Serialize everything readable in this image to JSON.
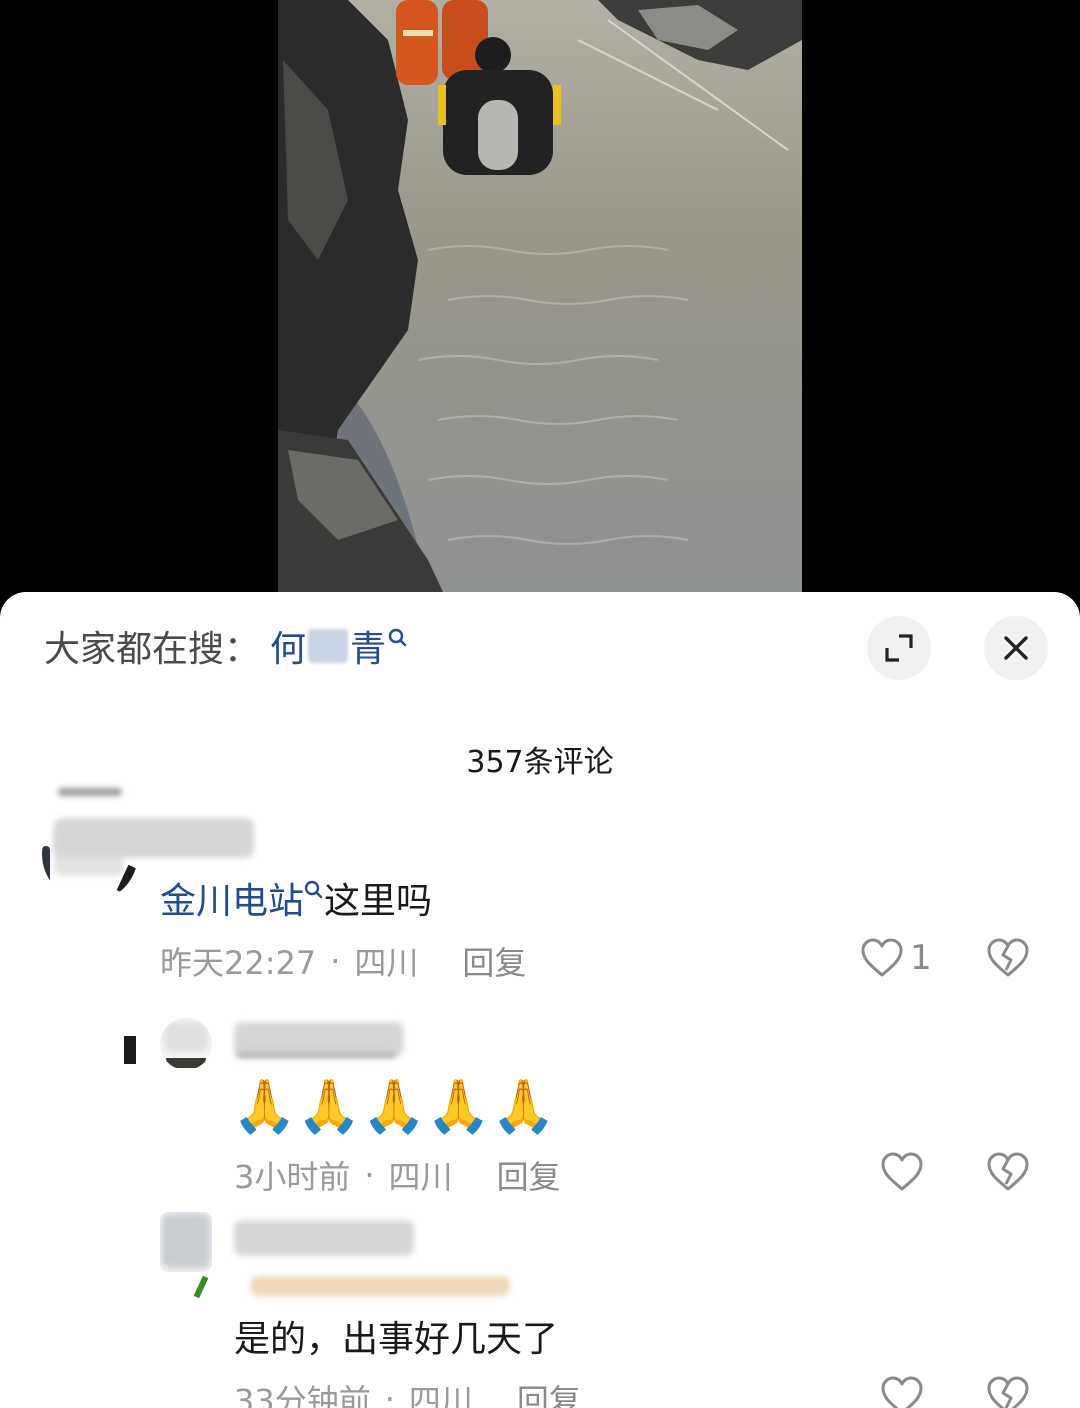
{
  "search": {
    "prefix": "大家都在搜：",
    "term_start": "何",
    "term_end": "青"
  },
  "comments_header": {
    "count_label": "357条评论"
  },
  "comments": [
    {
      "link_text": "金川电站",
      "text": "这里吗",
      "time": "昨天22:27",
      "location": "四川",
      "reply_label": "回复",
      "like_count": "1"
    }
  ],
  "replies": [
    {
      "emoji": "🙏🙏🙏🙏🙏",
      "time": "3小时前",
      "location": "四川",
      "reply_label": "回复"
    },
    {
      "text": "是的，出事好几天了",
      "time": "33分钟前",
      "location": "四川",
      "reply_label": "回复"
    }
  ],
  "meta_separator": "·",
  "icons": {
    "expand": "expand-icon",
    "close": "close-icon",
    "search": "search-icon",
    "like": "heart-icon",
    "dislike": "broken-heart-icon"
  },
  "colors": {
    "link": "#244b8f",
    "meta": "#9a9a9a",
    "sheet_bg": "#ffffff",
    "page_bg": "#000000"
  }
}
